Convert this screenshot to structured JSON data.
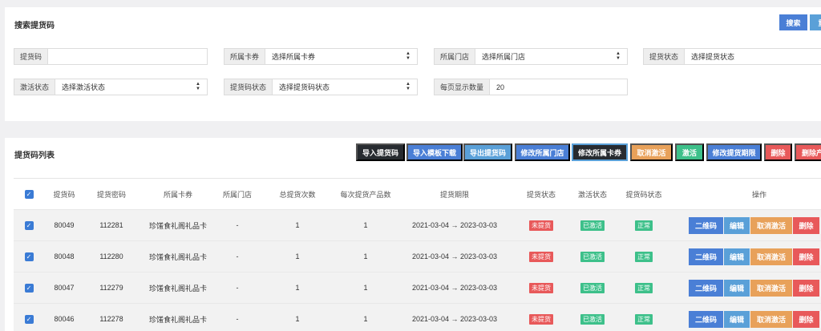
{
  "colors": {
    "blue": "#4a7fd6",
    "dark": "#272b30",
    "lightblue": "#5aa0d8",
    "orange": "#e8a15a",
    "green": "#3dc08a",
    "red": "#e8595a"
  },
  "search": {
    "title": "搜索提货码",
    "search_button": "搜索",
    "second_button": "重",
    "fields": {
      "code": {
        "label": "提货码",
        "value": ""
      },
      "card": {
        "label": "所属卡券",
        "value": "选择所属卡券"
      },
      "store": {
        "label": "所属门店",
        "value": "选择所属门店"
      },
      "pickup_status": {
        "label": "提货状态",
        "value": "选择提货状态"
      },
      "activation": {
        "label": "激活状态",
        "value": "选择激活状态"
      },
      "code_status": {
        "label": "提货码状态",
        "value": "选择提货码状态"
      },
      "page_size": {
        "label": "每页显示数量",
        "value": "20"
      }
    }
  },
  "list": {
    "title": "提货码列表",
    "toolbar": [
      {
        "id": "import-codes",
        "label": "导入提货码"
      },
      {
        "id": "import-template",
        "label": "导入模板下载"
      },
      {
        "id": "export-codes",
        "label": "导出提货码"
      },
      {
        "id": "modify-store",
        "label": "修改所属门店"
      },
      {
        "id": "modify-card",
        "label": "修改所属卡券"
      },
      {
        "id": "cancel-activate",
        "label": "取消激活"
      },
      {
        "id": "activate",
        "label": "激活"
      },
      {
        "id": "modify-period",
        "label": "修改提货期限"
      },
      {
        "id": "delete",
        "label": "删除"
      },
      {
        "id": "delete-product",
        "label": "删除产"
      }
    ],
    "columns": [
      "提货码",
      "提货密码",
      "所属卡券",
      "所属门店",
      "总提货次数",
      "每次提货产品数",
      "提货期限",
      "提货状态",
      "激活状态",
      "提货码状态",
      "操作"
    ],
    "rows": [
      {
        "code": "80049",
        "password": "112281",
        "card": "珍馐食礼阁礼品卡",
        "store": "-",
        "total": "1",
        "per": "1",
        "period": "2021-03-04 → 2023-03-03",
        "pickup": "未提货",
        "activation": "已激活",
        "status": "正常"
      },
      {
        "code": "80048",
        "password": "112280",
        "card": "珍馐食礼阁礼品卡",
        "store": "-",
        "total": "1",
        "per": "1",
        "period": "2021-03-04 → 2023-03-03",
        "pickup": "未提货",
        "activation": "已激活",
        "status": "正常"
      },
      {
        "code": "80047",
        "password": "112279",
        "card": "珍馐食礼阁礼品卡",
        "store": "-",
        "total": "1",
        "per": "1",
        "period": "2021-03-04 → 2023-03-03",
        "pickup": "未提货",
        "activation": "已激活",
        "status": "正常"
      },
      {
        "code": "80046",
        "password": "112278",
        "card": "珍馐食礼阁礼品卡",
        "store": "-",
        "total": "1",
        "per": "1",
        "period": "2021-03-04 → 2023-03-03",
        "pickup": "未提货",
        "activation": "已激活",
        "status": "正常"
      }
    ],
    "row_actions": {
      "qrcode": "二维码",
      "edit": "编辑",
      "cancel_activate": "取消激活",
      "delete": "删除"
    }
  }
}
